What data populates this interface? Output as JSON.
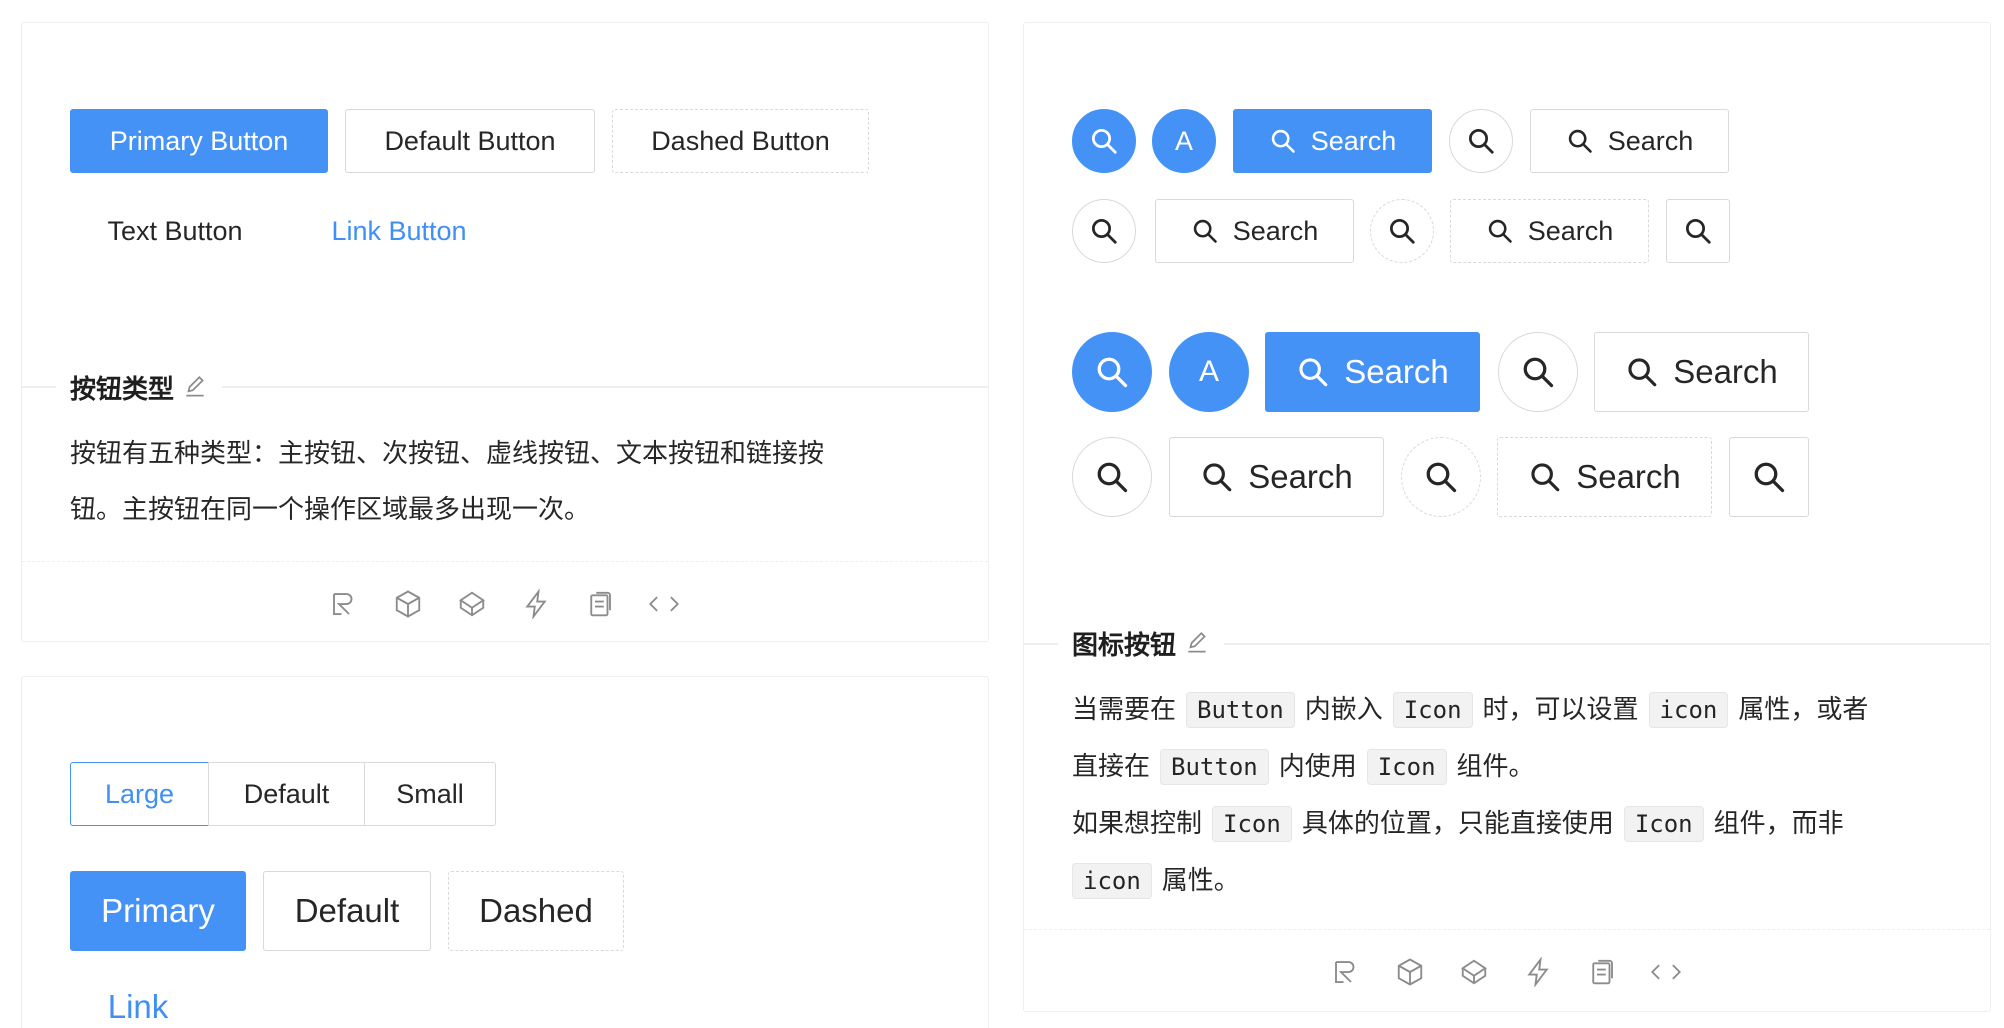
{
  "colors": {
    "primary": "#4592f6",
    "link": "#3f8ff4",
    "border": "#d9d9d9",
    "text": "#262626"
  },
  "icons": {
    "search": "search-icon",
    "edit": "edit-icon"
  },
  "button_types": {
    "primary": "Primary Button",
    "default": "Default Button",
    "dashed": "Dashed Button",
    "text": "Text Button",
    "link": "Link Button",
    "title": "按钮类型",
    "desc_line1": "按钮有五种类型：主按钮、次按钮、虚线按钮、文本按钮和链接按",
    "desc_line2": "钮。主按钮在同一个操作区域最多出现一次。"
  },
  "size_demo": {
    "radio": [
      "Large",
      "Default",
      "Small"
    ],
    "primary": "Primary",
    "default": "Default",
    "dashed": "Dashed",
    "link": "Link"
  },
  "icon_buttons": {
    "avatar_letter": "A",
    "search": "Search",
    "title": "图标按钮",
    "desc": {
      "p1_a": "当需要在",
      "p1_code1": "Button",
      "p1_b": "内嵌入",
      "p1_code2": "Icon",
      "p1_c": "时，可以设置",
      "p1_code3": "icon",
      "p1_d": "属性，或者",
      "p1_e": "直接在",
      "p1_code4": "Button",
      "p1_f": "内使用",
      "p1_code5": "Icon",
      "p1_g": "组件。",
      "p2_a": "如果想控制",
      "p2_code1": "Icon",
      "p2_b": "具体的位置，只能直接使用",
      "p2_code2": "Icon",
      "p2_c": "组件，而非",
      "p2_code3": "icon",
      "p2_d": "属性。"
    }
  },
  "action_icons": [
    "codesandbox-icon",
    "codepen-icon",
    "stackblitz-icon",
    "lightning-icon",
    "copy-icon",
    "code-expand-icon"
  ]
}
